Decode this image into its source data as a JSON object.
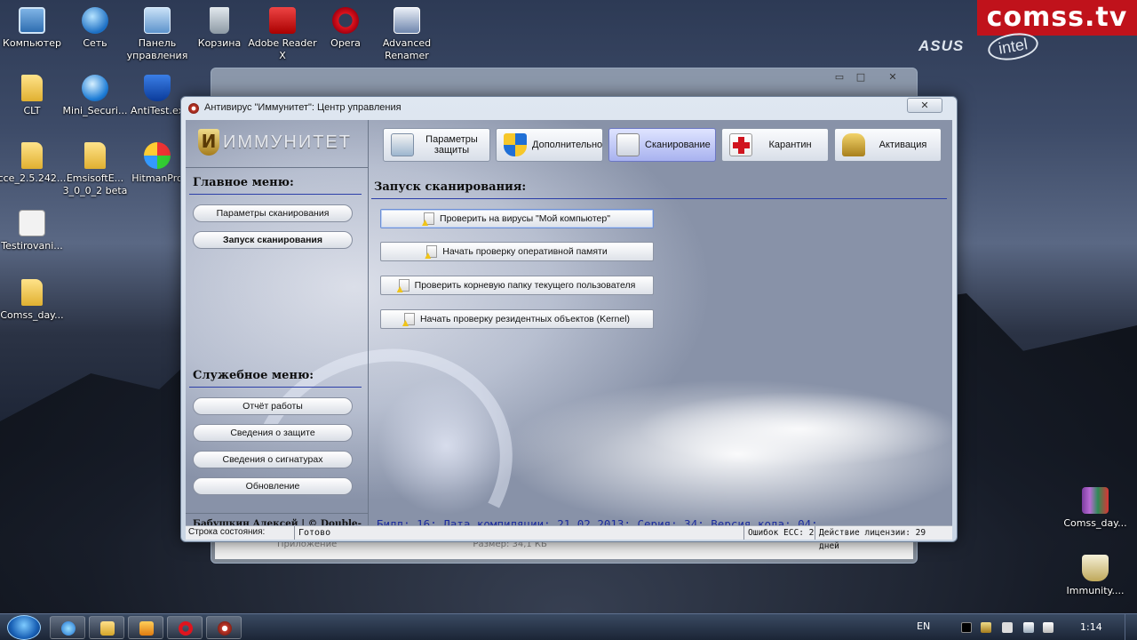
{
  "desktop": {
    "icons": [
      {
        "label": "Компьютер",
        "icon": "computer-icon"
      },
      {
        "label": "Сеть",
        "icon": "network-icon"
      },
      {
        "label": "Панель управления",
        "icon": "control-panel-icon"
      },
      {
        "label": "Корзина",
        "icon": "recycle-bin-icon"
      },
      {
        "label": "Adobe Reader X",
        "icon": "adobe-reader-icon"
      },
      {
        "label": "Opera",
        "icon": "opera-icon"
      },
      {
        "label": "Advanced Renamer",
        "icon": "renamer-icon"
      },
      {
        "label": "CLT",
        "icon": "folder-icon"
      },
      {
        "label": "Mini_Securi...",
        "icon": "globe-icon"
      },
      {
        "label": "AntiTest.ex",
        "icon": "shield-icon"
      },
      {
        "label": "cce_2.5.242...",
        "icon": "folder-icon"
      },
      {
        "label": "EmsisoftE... 3_0_0_2 beta",
        "icon": "folder-icon"
      },
      {
        "label": "HitmanPro",
        "icon": "hitmanpro-icon"
      },
      {
        "label": "Testirovani...",
        "icon": "document-icon"
      },
      {
        "label": "Comss_day...",
        "icon": "folder-icon"
      },
      {
        "label": "Comss_day...",
        "icon": "archive-icon"
      },
      {
        "label": "Immunity....",
        "icon": "immunity-icon"
      }
    ],
    "brand": "comss.tv",
    "asus": "ASUS",
    "intel": "intel"
  },
  "bg_window": {
    "bottom_left": "Приложение",
    "bottom_right": "Размер: 34,1 КБ",
    "min": "▭",
    "max": "□",
    "close": "✕"
  },
  "window": {
    "title": "Антивирус \"Иммунитет\": Центр управления",
    "close": "✕",
    "logo_mark": "И",
    "logo_text": "ИММУНИТЕТ",
    "top_buttons": [
      {
        "label": "Параметры защиты",
        "icon": "settings-icon",
        "active": false
      },
      {
        "label": "Дополнительно",
        "icon": "windows-shield-icon",
        "active": false
      },
      {
        "label": "Сканирование",
        "icon": "scan-icon",
        "active": true
      },
      {
        "label": "Карантин",
        "icon": "quarantine-icon",
        "active": false
      },
      {
        "label": "Активация",
        "icon": "lock-icon",
        "active": false
      }
    ],
    "main_menu": {
      "title": "Главное меню:",
      "items": [
        "Параметры сканирования",
        "Запуск сканирования"
      ],
      "selected": "Запуск сканирования"
    },
    "service_menu": {
      "title": "Служебное меню:",
      "items": [
        "Отчёт работы",
        "Сведения о защите",
        "Сведения о сигнатурах",
        "Обновление"
      ]
    },
    "author": "Бабушкин Алексей | © Double-A",
    "content": {
      "heading": "Запуск сканирования:",
      "buttons": [
        "Проверить на вирусы \"Мой компьютер\"",
        "Начать проверку оперативной памяти",
        "Проверить корневую папку текущего пользователя",
        "Начать проверку резидентных объектов (Kernel)"
      ]
    },
    "build_line": "Билд: 16; Дата компиляции: 21.02.2013; Серия: 34; Версия кода: 04;",
    "status": {
      "label": "Строка состояния:",
      "value": "Готово",
      "errors": "Ошибок ЕСС: 2",
      "license": "Действие лицензии: 29 дней"
    }
  },
  "taskbar": {
    "lang": "EN",
    "time": "1:14",
    "apps": [
      "internet-explorer-icon",
      "explorer-folder-icon",
      "media-player-icon",
      "opera-icon",
      "immunity-icon"
    ]
  },
  "colors": {
    "accent_line": "#2c3fa8",
    "build_text": "#1a2a9c",
    "brand_red": "#c0121b"
  }
}
